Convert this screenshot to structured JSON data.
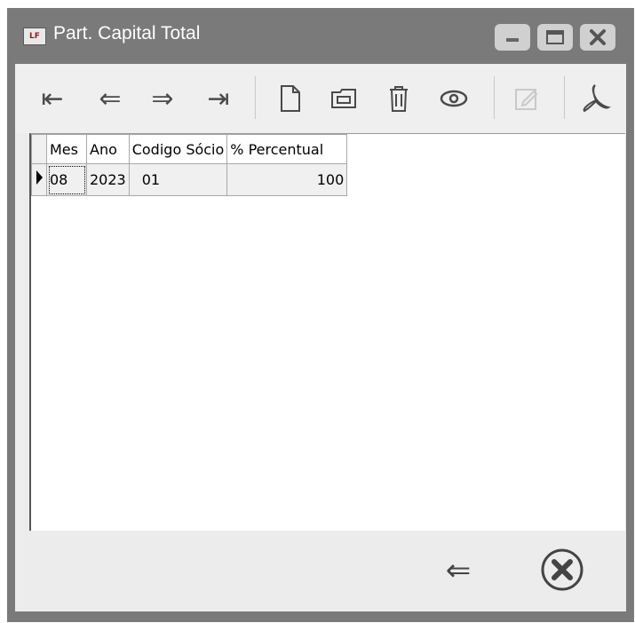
{
  "window": {
    "app_icon": "LF",
    "title": "Part. Capital Total",
    "controls": [
      "minimize-icon",
      "maximize-icon",
      "close-icon"
    ]
  },
  "toolbar": {
    "first": "⇤",
    "prev": "⇐",
    "next": "⇒",
    "last": "⇥",
    "icons": [
      "first-record-icon",
      "prev-record-icon",
      "next-record-icon",
      "last-record-icon",
      "new-document-icon",
      "open-folder-icon",
      "trash-icon",
      "eye-icon",
      "edit-icon",
      "pdf-icon"
    ]
  },
  "grid": {
    "columns": [
      "Mes",
      "Ano",
      "Codigo Sócio",
      "% Percentual"
    ],
    "rows": [
      {
        "mes": "08",
        "ano": "2023",
        "codigo": "01",
        "percentual": "100"
      }
    ]
  },
  "footer": {
    "back": "⇐",
    "icons": [
      "back-arrow-icon",
      "close-circle-icon"
    ]
  }
}
